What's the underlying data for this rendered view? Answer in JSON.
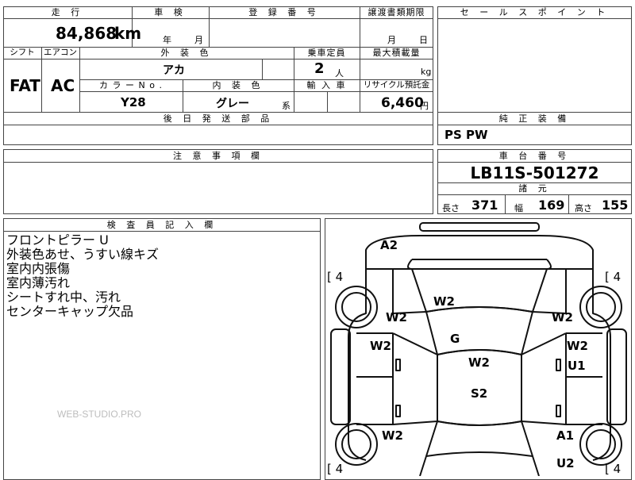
{
  "top_row": {
    "mileage_header": "走 行",
    "shaken_header": "車 検",
    "registration_header": "登 録 番 号",
    "transfer_header": "譲渡書類期限",
    "mileage_value": "84,868",
    "mileage_unit": "km",
    "shaken_year": "年",
    "shaken_month": "月",
    "transfer_month": "月",
    "transfer_day": "日"
  },
  "second_row": {
    "shift_header": "シフト",
    "aircon_header": "エアコン",
    "exterior_color_header": "外 装 色",
    "capacity_header": "乗車定員",
    "max_load_header": "最大積載量",
    "shift_value": "FAT",
    "aircon_value": "AC",
    "exterior_color_value": "アカ",
    "capacity_value": "2",
    "capacity_unit": "人",
    "max_load_unit": "kg",
    "color_no_header": "カ ラ ー  N o .",
    "interior_color_header": "内 装 色",
    "import_header": "輸 入 車",
    "recycle_header": "リサイクル預託金",
    "color_no_value": "Y28",
    "interior_color_value": "グレー",
    "interior_color_suffix": "系",
    "recycle_value": "6,460",
    "recycle_unit": "円"
  },
  "later_parts_header": "後 日 発 送 部 品",
  "sales_point_header": "セ ー ル ス ポ イ ン ト",
  "genuine_equipment": {
    "header": "純 正 装 備",
    "value": "PS PW"
  },
  "notes_header": "注 意 事 項 欄",
  "chassis": {
    "header": "車 台 番 号",
    "value": "LB11S-501272",
    "specs_header": "諸 元",
    "length_label": "長さ",
    "length_value": "371",
    "width_label": "幅",
    "width_value": "169",
    "height_label": "高さ",
    "height_value": "155"
  },
  "inspector": {
    "header": "検 査 員 記 入 欄",
    "lines": [
      "フロントピラー U",
      "外装色あせ、うすい線キズ",
      "室内内張傷",
      "室内薄汚れ",
      "シートすれ中、汚れ",
      "センターキャップ欠品"
    ],
    "watermark": "WEB-STUDIO.PRO"
  },
  "diagram": {
    "tire_labels": [
      "[ 4",
      "[ 4",
      "[ 4",
      "[ 4"
    ],
    "marks": {
      "front_bumper": "A2",
      "hood": "W2",
      "left_front_fender": "W2",
      "right_front_fender": "W2",
      "windshield": "G",
      "left_front_door": "W2",
      "right_front_door": "W2",
      "right_front_door_2": "U1",
      "roof": "W2",
      "rear_roof": "S2",
      "left_rear_fender": "W2",
      "right_rear_fender": "A1",
      "right_rear_bottom": "U2"
    }
  }
}
